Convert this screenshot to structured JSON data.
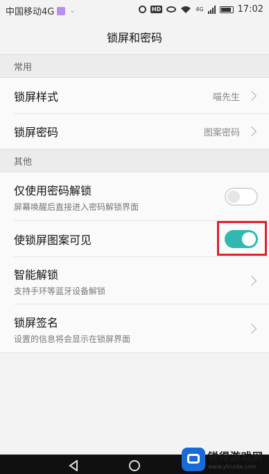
{
  "status_bar": {
    "carrier": "中国移动4G",
    "time": "17:02",
    "network_small": "4G",
    "hd": "HD"
  },
  "title": "锁屏和密码",
  "sections": [
    {
      "header": "常用"
    },
    {
      "header": "其他"
    }
  ],
  "rows": {
    "lock_style": {
      "label": "锁屏样式",
      "value": "喵先生"
    },
    "lock_password": {
      "label": "锁屏密码",
      "value": "图案密码"
    },
    "password_only": {
      "label": "仅使用密码解锁",
      "sub": "屏幕唤醒后直接进入密码解锁界面",
      "toggle": false
    },
    "pattern_visible": {
      "label": "使锁屏图案可见",
      "toggle": true
    },
    "smart_unlock": {
      "label": "智能解锁",
      "sub": "支持手环等蓝牙设备解锁"
    },
    "lock_signature": {
      "label": "锁屏签名",
      "sub": "设置的信息将会显示在锁屏界面"
    }
  },
  "watermark": {
    "title": "锐得游戏网",
    "url": "www.ytruida.com"
  },
  "colors": {
    "toggle_on": "#30b9b0",
    "highlight": "#e0202a"
  }
}
